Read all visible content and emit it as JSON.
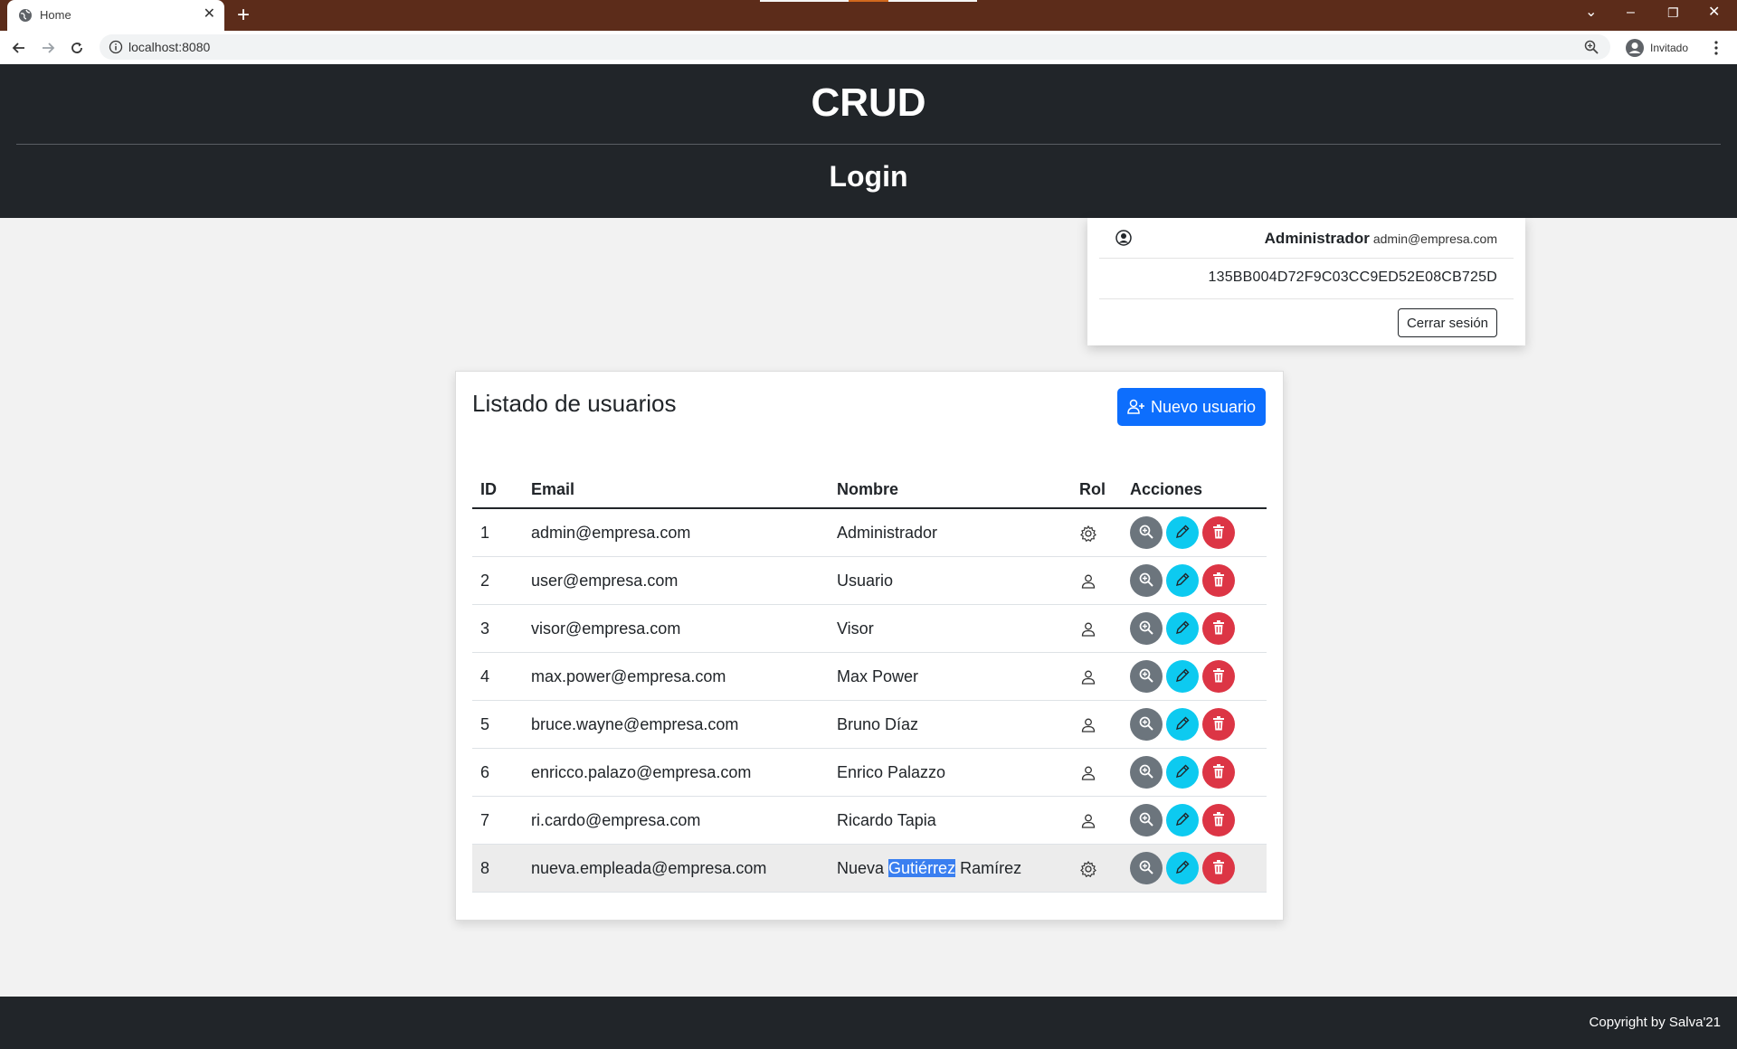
{
  "browser": {
    "tab_title": "Home",
    "url": "localhost:8080",
    "profile_label": "Invitado"
  },
  "header": {
    "title": "CRUD",
    "subtitle": "Login"
  },
  "user_card": {
    "name": "Administrador",
    "email": "admin@empresa.com",
    "token": "135BB004D72F9C03CC9ED52E08CB725D",
    "logout_label": "Cerrar sesión"
  },
  "users_list": {
    "title": "Listado de usuarios",
    "new_user_label": "Nuevo usuario",
    "columns": [
      "ID",
      "Email",
      "Nombre",
      "Rol",
      "Acciones"
    ],
    "rows": [
      {
        "id": "1",
        "email": "admin@empresa.com",
        "name": "Administrador",
        "role_icon": "gear-icon"
      },
      {
        "id": "2",
        "email": "user@empresa.com",
        "name": "Usuario",
        "role_icon": "person-icon"
      },
      {
        "id": "3",
        "email": "visor@empresa.com",
        "name": "Visor",
        "role_icon": "person-icon"
      },
      {
        "id": "4",
        "email": "max.power@empresa.com",
        "name": "Max Power",
        "role_icon": "person-icon"
      },
      {
        "id": "5",
        "email": "bruce.wayne@empresa.com",
        "name": "Bruno Díaz",
        "role_icon": "person-icon"
      },
      {
        "id": "6",
        "email": "enricco.palazo@empresa.com",
        "name": "Enrico Palazzo",
        "role_icon": "person-icon"
      },
      {
        "id": "7",
        "email": "ri.cardo@empresa.com",
        "name": "Ricardo Tapia",
        "role_icon": "person-icon"
      },
      {
        "id": "8",
        "email": "nueva.empleada@empresa.com",
        "name_parts": [
          "Nueva",
          "Gutiérrez",
          "Ramírez"
        ],
        "role_icon": "gear-icon"
      }
    ],
    "action_icons": [
      "zoom-in-icon",
      "pencil-icon",
      "trash-icon"
    ]
  },
  "footer": {
    "copyright": "Copyright by Salva'21"
  },
  "colors": {
    "tabbar": "#5c2c1a",
    "dark": "#212529",
    "primary": "#0d6efd",
    "info": "#0dcaf0",
    "danger": "#dc3545",
    "secondary": "#6c757d",
    "selection": "#3a7ff0"
  }
}
